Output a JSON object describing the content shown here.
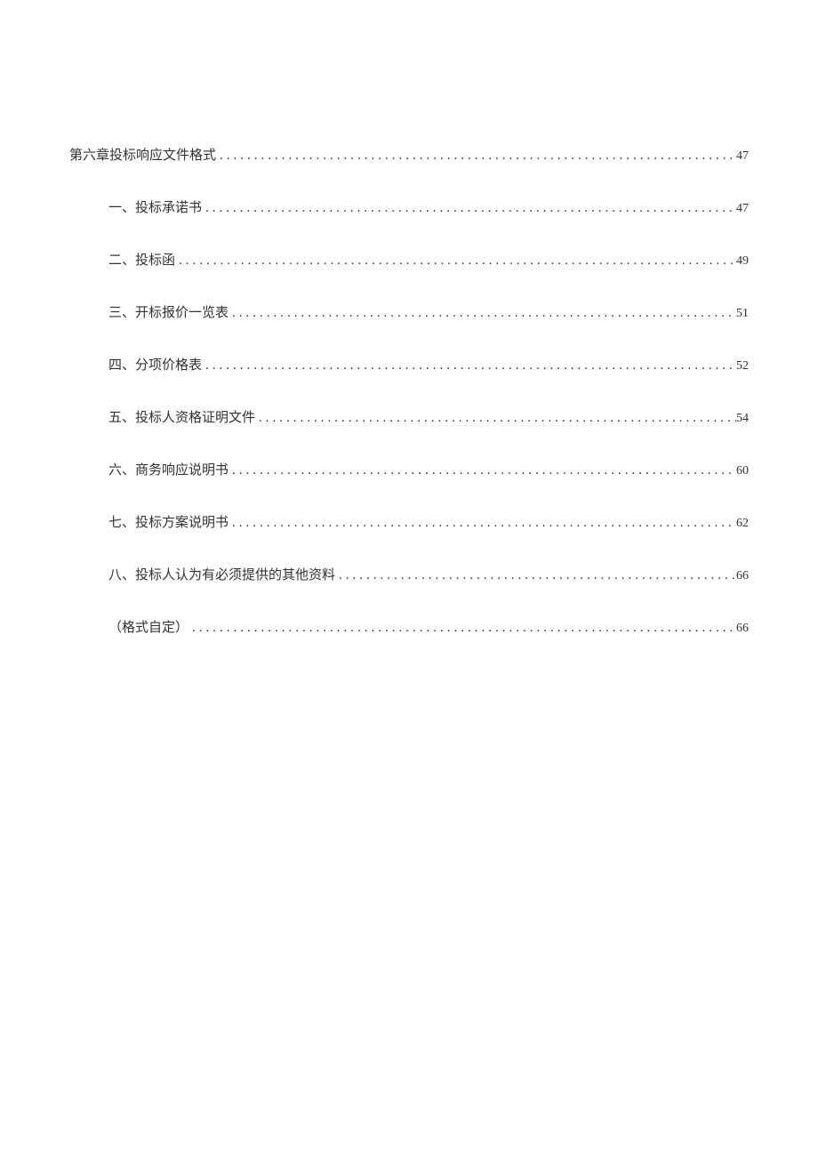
{
  "toc": {
    "entries": [
      {
        "level": 1,
        "label": "第六章投标响应文件格式",
        "page": "47"
      },
      {
        "level": 2,
        "label": "一、投标承诺书",
        "page": "47"
      },
      {
        "level": 2,
        "label": "二、投标函",
        "page": "49"
      },
      {
        "level": 2,
        "label": "三、开标报价一览表",
        "page": "51"
      },
      {
        "level": 2,
        "label": "四、分项价格表",
        "page": "52"
      },
      {
        "level": 2,
        "label": "五、投标人资格证明文件",
        "page": "54"
      },
      {
        "level": 2,
        "label": "六、商务响应说明书",
        "page": "60"
      },
      {
        "level": 2,
        "label": "七、投标方案说明书",
        "page": "62"
      },
      {
        "level": 2,
        "label": "八、投标人认为有必须提供的其他资料",
        "page": "66"
      },
      {
        "level": 2,
        "label": "（格式自定）",
        "page": "66"
      }
    ]
  }
}
